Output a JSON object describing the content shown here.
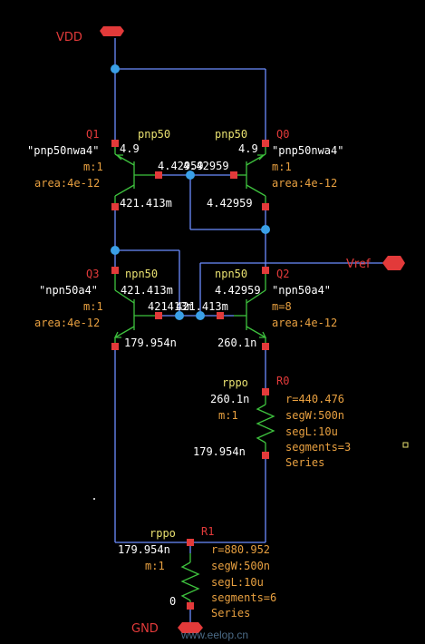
{
  "pins": {
    "vdd": "VDD",
    "gnd": "GND",
    "vref": "Vref"
  },
  "devices": {
    "q1": {
      "inst": "Q1",
      "cell": "pnp50",
      "model": "\"pnp50nwa4\"",
      "m": "m:1",
      "area": "area:4e-12",
      "vb": "4.9"
    },
    "q0": {
      "inst": "Q0",
      "cell": "pnp50",
      "model": "\"pnp50nwa4\"",
      "m": "m:1",
      "area": "area:4e-12",
      "vb": "4.9"
    },
    "q3": {
      "inst": "Q3",
      "cell": "npn50",
      "model": "\"npn50a4\"",
      "m": "m:1",
      "area": "area:4e-12"
    },
    "q2": {
      "inst": "Q2",
      "cell": "npn50",
      "model": "\"npn50a4\"",
      "m": "m=8",
      "area": "area:4e-12"
    },
    "r0": {
      "inst": "R0",
      "cell": "rppo",
      "r": "r=440.476",
      "segW": "segW:500n",
      "segL": "segL:10u",
      "segments": "segments=3",
      "conn": "Series",
      "m": "m:1"
    },
    "r1": {
      "inst": "R1",
      "cell": "rppo",
      "r": "r=880.952",
      "segW": "segW:500n",
      "segL": "segL:10u",
      "segments": "segments=6",
      "conn": "Series",
      "m": "m:1"
    }
  },
  "annotations": {
    "pnp_base": "4.42959",
    "pnp_base_overlap": "4.42959",
    "q1_coll": "421.413m",
    "q0_coll": "4.42959",
    "q3_coll": "421.413m",
    "q2_coll": "4.42959",
    "npn_base_left": "421413m",
    "npn_base_right": "421.413m",
    "q3_emit": "179.954n",
    "q2_emit": "260.1n",
    "r0_top": "260.1n",
    "r0_bot": "179.954n",
    "r1_top": "179.954n",
    "r1_bot": "0"
  },
  "watermark": "www.eelop.cn",
  "colors": {
    "wire": "#6b8cff",
    "pin_red": "#e23a3a",
    "device_green": "#3ec23e",
    "node_dot": "#3aa0e8",
    "label_yellow": "#e8e070"
  }
}
